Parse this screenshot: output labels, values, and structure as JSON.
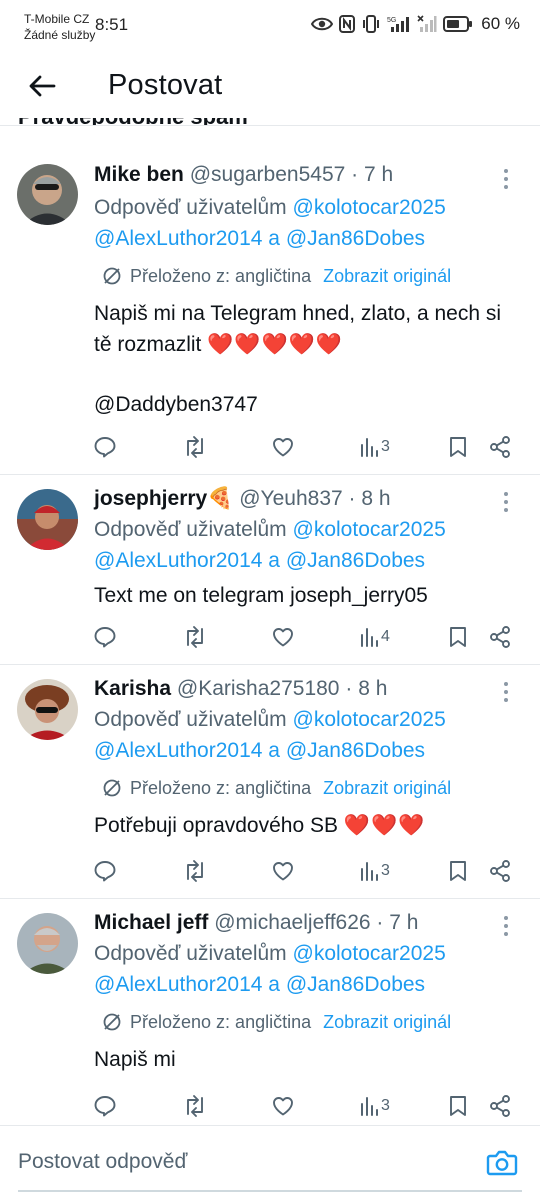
{
  "status_bar": {
    "carrier_line1": "T-Mobile CZ",
    "carrier_line2": "Žádné služby",
    "time": "8:51",
    "battery": "60 %"
  },
  "header": {
    "title": "Postovat",
    "partial_previous_text": "Pravděpodobně spam"
  },
  "posts": [
    {
      "name": "Mike ben",
      "handle": "@sugarben5457",
      "separator": "·",
      "time": "7 h",
      "reply_prefix": "Odpověď uživatelům",
      "mention1": "@kolotocar2025",
      "mention2": "@AlexLuthor2014",
      "conj": "a",
      "mention3": "@Jan86Dobes",
      "translated_label": "Přeloženo z: angličtina",
      "show_original": "Zobrazit originál",
      "text": "Napiš mi na Telegram hned, zlato, a nech si tě rozmazlit",
      "hearts": "❤️❤️❤️❤️❤️",
      "text2": "@Daddyben3747",
      "views": "3"
    },
    {
      "name": "josephjerry",
      "name_emoji": "🍕",
      "handle": "@Yeuh837",
      "separator": "·",
      "time": "8 h",
      "reply_prefix": "Odpověď uživatelům",
      "mention1": "@kolotocar2025",
      "mention2": "@AlexLuthor2014",
      "conj": "a",
      "mention3": "@Jan86Dobes",
      "text": "Text me on telegram joseph_jerry05",
      "views": "4"
    },
    {
      "name": "Karisha",
      "handle": "@Karisha275180",
      "separator": "·",
      "time": "8 h",
      "reply_prefix": "Odpověď uživatelům",
      "mention1": "@kolotocar2025",
      "mention2": "@AlexLuthor2014",
      "conj": "a",
      "mention3": "@Jan86Dobes",
      "translated_label": "Přeloženo z: angličtina",
      "show_original": "Zobrazit originál",
      "text": "Potřebuji opravdového SB",
      "hearts": "❤️❤️❤️",
      "views": "3"
    },
    {
      "name": "Michael jeff",
      "handle": "@michaeljeff626",
      "separator": "·",
      "time": "7 h",
      "reply_prefix": "Odpověď uživatelům",
      "mention1": "@kolotocar2025",
      "mention2": "@AlexLuthor2014",
      "conj": "a",
      "mention3": "@Jan86Dobes",
      "translated_label": "Přeloženo z: angličtina",
      "show_original": "Zobrazit originál",
      "text": "Napiš mi",
      "views": "3"
    }
  ],
  "composer": {
    "placeholder": "Postovat odpověď"
  },
  "colors": {
    "link": "#1d9bf0",
    "secondary_text": "#536471",
    "heart": "#e0245e",
    "divider": "#e6e9ec"
  }
}
